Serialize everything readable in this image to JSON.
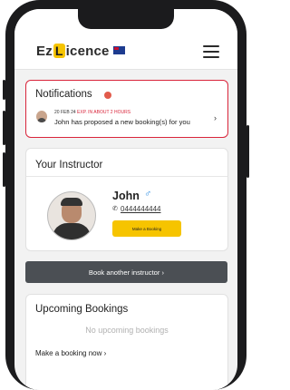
{
  "header": {
    "logo_text_1": "Ez",
    "logo_mark": "L",
    "logo_text_2": "icence",
    "flag_icon": "australian-flag-icon",
    "menu_icon": "hamburger-menu-icon"
  },
  "notifications": {
    "title": "Notifications",
    "date": "20 FEB 24",
    "expiry": "EXP. IN ABOUT 2 HOURS",
    "message": "John has proposed a new booking(s) for you",
    "chevron": "›"
  },
  "instructor": {
    "title": "Your Instructor",
    "name": "John",
    "gender_symbol": "♂",
    "phone": "0444444444",
    "booking_button": "Make a Booking"
  },
  "another_instructor_button": "Book another instructor ›",
  "upcoming": {
    "title": "Upcoming Bookings",
    "empty_text": "No upcoming bookings",
    "make_booking_link": "Make a booking now ›"
  },
  "colors": {
    "accent_yellow": "#f6c400",
    "alert_red": "#d9253b",
    "button_dark": "#4b4f54",
    "gender_blue": "#2a8be0"
  }
}
